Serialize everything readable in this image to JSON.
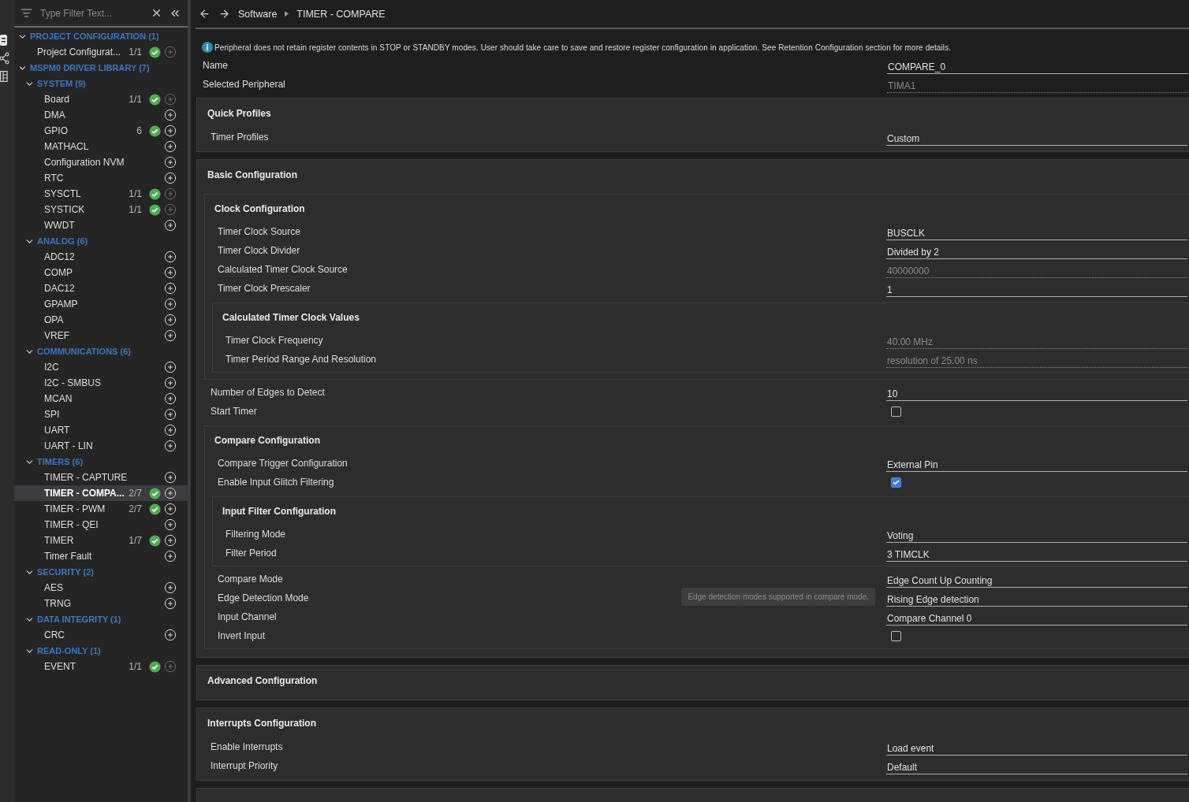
{
  "sidebar": {
    "filter_placeholder": "Type Filter Text...",
    "tree": [
      {
        "label": "PROJECT CONFIGURATION (1)",
        "expanded": true,
        "children": [
          {
            "label": "Project Configurat...",
            "count": "1/1",
            "ok": true,
            "addable": false,
            "selected": false
          }
        ]
      },
      {
        "label": "MSPM0 DRIVER LIBRARY (7)",
        "expanded": true,
        "children": [
          {
            "label": "SYSTEM (9)",
            "expanded": true,
            "children": [
              {
                "label": "Board",
                "count": "1/1",
                "ok": true,
                "addable": false,
                "selected": false
              },
              {
                "label": "DMA",
                "ok": false,
                "addable": true,
                "selected": false
              },
              {
                "label": "GPIO",
                "count": "6",
                "ok": true,
                "addable": true,
                "selected": false
              },
              {
                "label": "MATHACL",
                "ok": false,
                "addable": true,
                "selected": false
              },
              {
                "label": "Configuration NVM",
                "ok": false,
                "addable": true,
                "selected": false
              },
              {
                "label": "RTC",
                "ok": false,
                "addable": true,
                "selected": false
              },
              {
                "label": "SYSCTL",
                "count": "1/1",
                "ok": true,
                "addable": false,
                "selected": false
              },
              {
                "label": "SYSTICK",
                "count": "1/1",
                "ok": true,
                "addable": false,
                "selected": false
              },
              {
                "label": "WWDT",
                "ok": false,
                "addable": true,
                "selected": false
              }
            ]
          },
          {
            "label": "ANALOG (6)",
            "expanded": true,
            "children": [
              {
                "label": "ADC12",
                "ok": false,
                "addable": true,
                "selected": false
              },
              {
                "label": "COMP",
                "ok": false,
                "addable": true,
                "selected": false
              },
              {
                "label": "DAC12",
                "ok": false,
                "addable": true,
                "selected": false
              },
              {
                "label": "GPAMP",
                "ok": false,
                "addable": true,
                "selected": false
              },
              {
                "label": "OPA",
                "ok": false,
                "addable": true,
                "selected": false
              },
              {
                "label": "VREF",
                "ok": false,
                "addable": true,
                "selected": false
              }
            ]
          },
          {
            "label": "COMMUNICATIONS (6)",
            "expanded": true,
            "children": [
              {
                "label": "I2C",
                "ok": false,
                "addable": true,
                "selected": false
              },
              {
                "label": "I2C - SMBUS",
                "ok": false,
                "addable": true,
                "selected": false
              },
              {
                "label": "MCAN",
                "ok": false,
                "addable": true,
                "selected": false
              },
              {
                "label": "SPI",
                "ok": false,
                "addable": true,
                "selected": false
              },
              {
                "label": "UART",
                "ok": false,
                "addable": true,
                "selected": false
              },
              {
                "label": "UART - LIN",
                "ok": false,
                "addable": true,
                "selected": false
              }
            ]
          },
          {
            "label": "TIMERS (6)",
            "expanded": true,
            "children": [
              {
                "label": "TIMER - CAPTURE",
                "ok": false,
                "addable": true,
                "selected": false
              },
              {
                "label": "TIMER - COMPA...",
                "count": "2/7",
                "ok": true,
                "addable": true,
                "selected": true
              },
              {
                "label": "TIMER - PWM",
                "count": "2/7",
                "ok": true,
                "addable": true,
                "selected": false
              },
              {
                "label": "TIMER - QEI",
                "ok": false,
                "addable": true,
                "selected": false
              },
              {
                "label": "TIMER",
                "count": "1/7",
                "ok": true,
                "addable": true,
                "selected": false
              },
              {
                "label": "Timer Fault",
                "ok": false,
                "addable": true,
                "selected": false
              }
            ]
          },
          {
            "label": "SECURITY (2)",
            "expanded": true,
            "children": [
              {
                "label": "AES",
                "ok": false,
                "addable": true,
                "selected": false
              },
              {
                "label": "TRNG",
                "ok": false,
                "addable": true,
                "selected": false
              }
            ]
          },
          {
            "label": "DATA INTEGRITY (1)",
            "expanded": true,
            "children": [
              {
                "label": "CRC",
                "ok": false,
                "addable": true,
                "selected": false
              }
            ]
          },
          {
            "label": "READ-ONLY (1)",
            "expanded": true,
            "children": [
              {
                "label": "EVENT",
                "count": "1/1",
                "ok": true,
                "addable": false,
                "selected": false
              }
            ]
          }
        ]
      }
    ]
  },
  "breadcrumb": [
    "Software",
    "TIMER - COMPARE"
  ],
  "notice": "Peripheral does not retain register contents in STOP or STANDBY modes. User should take care to save and restore register configuration in application. See Retention Configuration section for more details.",
  "header_fields": [
    {
      "kind": "field",
      "label": "Name",
      "value": "COMPARE_0",
      "readonly": false
    },
    {
      "kind": "field",
      "label": "Selected Peripheral",
      "value": "TIMA1",
      "readonly": true
    }
  ],
  "sections": [
    {
      "kind": "card",
      "title": "Quick Profiles",
      "items": [
        {
          "kind": "field",
          "label": "Timer Profiles",
          "value": "Custom",
          "readonly": false
        }
      ]
    },
    {
      "kind": "card",
      "title": "Basic Configuration",
      "items": [
        {
          "kind": "group",
          "title": "Clock Configuration",
          "items": [
            {
              "kind": "field",
              "label": "Timer Clock Source",
              "value": "BUSCLK",
              "readonly": false
            },
            {
              "kind": "field",
              "label": "Timer Clock Divider",
              "value": "Divided by 2",
              "readonly": false
            },
            {
              "kind": "field",
              "label": "Calculated Timer Clock Source",
              "value": "40000000",
              "readonly": true
            },
            {
              "kind": "field",
              "label": "Timer Clock Prescaler",
              "value": "1",
              "readonly": false
            },
            {
              "kind": "group",
              "title": "Calculated Timer Clock Values",
              "items": [
                {
                  "kind": "field",
                  "label": "Timer Clock Frequency",
                  "value": "40.00 MHz",
                  "readonly": true
                },
                {
                  "kind": "field",
                  "label": "Timer Period Range And Resolution",
                  "value": "resolution of 25.00 ns",
                  "readonly": true
                }
              ]
            }
          ]
        },
        {
          "kind": "field",
          "label": "Number of Edges to Detect",
          "value": "10",
          "readonly": false
        },
        {
          "kind": "checkbox",
          "label": "Start Timer",
          "checked": false
        },
        {
          "kind": "group",
          "title": "Compare Configuration",
          "items": [
            {
              "kind": "field",
              "label": "Compare Trigger Configuration",
              "value": "External Pin",
              "readonly": false
            },
            {
              "kind": "checkbox",
              "label": "Enable Input Glitch Filtering",
              "checked": true
            },
            {
              "kind": "group",
              "title": "Input Filter Configuration",
              "items": [
                {
                  "kind": "field",
                  "label": "Filtering Mode",
                  "value": "Voting",
                  "readonly": false
                },
                {
                  "kind": "field",
                  "label": "Filter Period",
                  "value": "3 TIMCLK",
                  "readonly": false
                }
              ]
            },
            {
              "kind": "field",
              "label": "Compare Mode",
              "value": "Edge Count Up Counting",
              "readonly": false
            },
            {
              "kind": "field",
              "label": "Edge Detection Mode",
              "value": "Rising Edge detection",
              "readonly": false,
              "hint": "Edge detection modes supported in compare mode."
            },
            {
              "kind": "field",
              "label": "Input Channel",
              "value": "Compare Channel 0",
              "readonly": false
            },
            {
              "kind": "checkbox",
              "label": "Invert Input",
              "checked": false
            }
          ]
        }
      ]
    },
    {
      "kind": "card",
      "title": "Advanced Configuration"
    },
    {
      "kind": "card",
      "title": "Interrupts Configuration",
      "items": [
        {
          "kind": "field",
          "label": "Enable Interrupts",
          "value": "Load event",
          "readonly": false
        },
        {
          "kind": "field",
          "label": "Interrupt Priority",
          "value": "Default",
          "readonly": false
        }
      ]
    },
    {
      "kind": "placeholder"
    }
  ]
}
